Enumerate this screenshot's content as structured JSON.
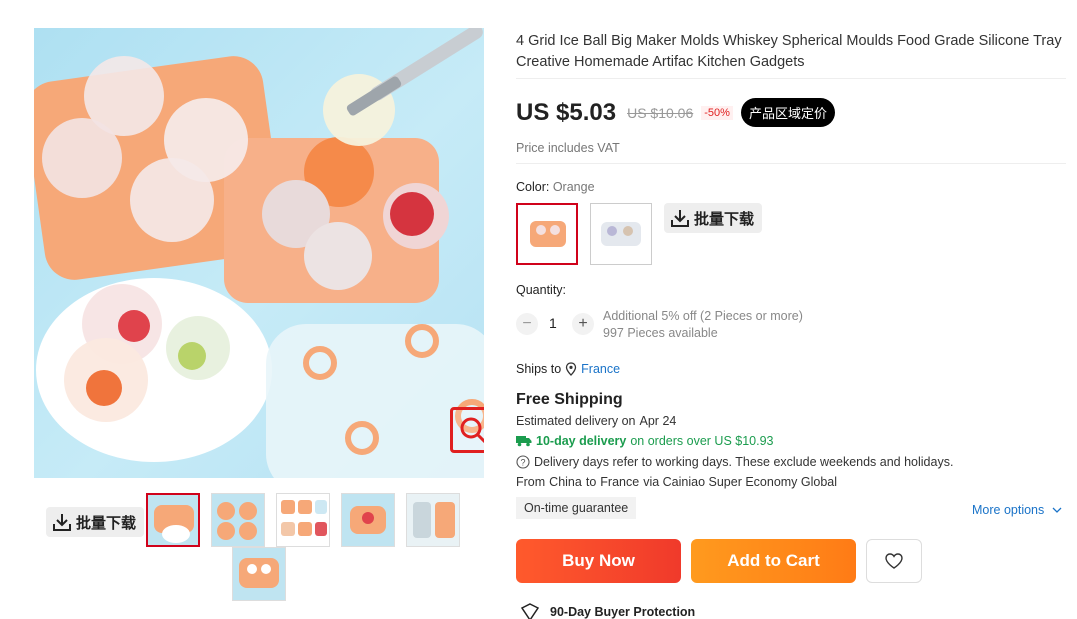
{
  "gallery": {
    "batch_download_label": "批量下载",
    "thumbnail_count": 6,
    "selected_thumbnail": 1
  },
  "product": {
    "title": "4 Grid Ice Ball Big Maker Molds Whiskey Spherical Moulds Food Grade Silicone Tray Creative Homemade Artifac Kitchen Gadgets",
    "price": "US $5.03",
    "original_price": "US $10.06",
    "discount": "-50%",
    "region_price_badge": "产品区域定价",
    "vat_note": "Price includes VAT"
  },
  "color": {
    "label": "Color:",
    "selected_value": "Orange",
    "batch_download_label": "批量下载"
  },
  "quantity": {
    "label": "Quantity:",
    "value": "1",
    "minus": "−",
    "plus": "+",
    "discount_note": "Additional 5% off (2 Pieces or more)",
    "available": "997 Pieces available"
  },
  "shipping": {
    "ships_to_label": "Ships to",
    "country": "France",
    "free_shipping": "Free Shipping",
    "estimated_delivery_prefix": "Estimated delivery on",
    "estimated_delivery_date": "Apr 24",
    "fast_delivery_bold": "10-day delivery",
    "fast_delivery_rest": "on orders over US $10.93",
    "working_days_note": "Delivery days refer to working days. These exclude weekends and holidays.",
    "route_from_label": "From",
    "route_from": "China",
    "route_to_label": "to",
    "route_to": "France",
    "route_via": "via Cainiao Super Economy Global",
    "guarantee": "On-time guarantee",
    "more_options": "More options"
  },
  "actions": {
    "buy_now": "Buy Now",
    "add_to_cart": "Add to Cart"
  },
  "protection": {
    "label": "90-Day Buyer Protection"
  },
  "colors": {
    "accent_red": "#d0021b",
    "buy_now": "#f5422b",
    "add_to_cart": "#ff8c1a",
    "link_blue": "#1a73c8",
    "delivery_green": "#1b9c4e",
    "product_orange": "#f6a878"
  }
}
